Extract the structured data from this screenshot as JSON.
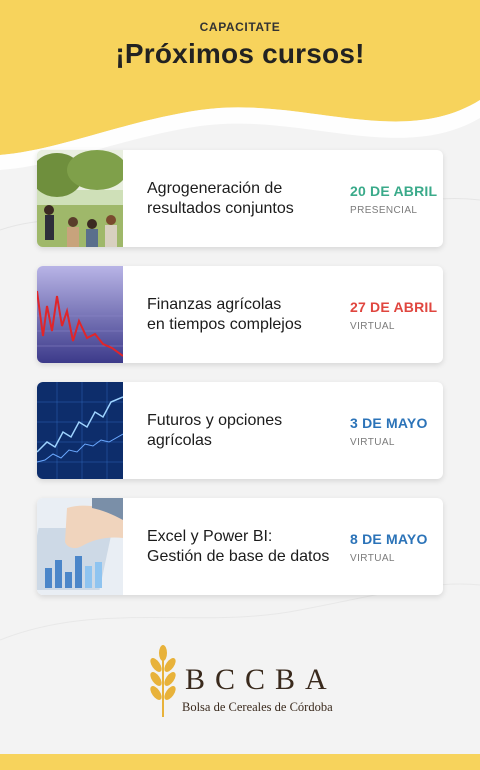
{
  "header": {
    "eyebrow": "CAPACITATE",
    "title": "¡Próximos cursos!"
  },
  "colors": {
    "accent_yellow": "#f7d35c",
    "date_green": "#3aaa8a",
    "date_red": "#e0463f",
    "date_blue": "#2b73b8",
    "logo_brown": "#3a2a1d",
    "logo_gold": "#e8b23a"
  },
  "courses": [
    {
      "title": "Agrogeneración de\nresultados conjuntos",
      "date": "20 DE ABRIL",
      "mode": "PRESENCIAL",
      "date_color": "#3aaa8a",
      "thumb": "outdoor-class-photo"
    },
    {
      "title": "Finanzas agrícolas\nen tiempos complejos",
      "date": "27 DE ABRIL",
      "mode": "VIRTUAL",
      "date_color": "#e0463f",
      "thumb": "red-falling-chart"
    },
    {
      "title": "Futuros y opciones\nagrícolas",
      "date": "3 DE MAYO",
      "mode": "VIRTUAL",
      "date_color": "#2b73b8",
      "thumb": "blue-market-chart"
    },
    {
      "title": "Excel y Power BI:\nGestión de base de datos",
      "date": "8 DE MAYO",
      "mode": "VIRTUAL",
      "date_color": "#2b73b8",
      "thumb": "hand-on-tablet-chart"
    }
  ],
  "logo": {
    "wordmark": "BCCBA",
    "subline": "Bolsa de Cereales de Córdoba",
    "icon": "wheat-icon"
  }
}
